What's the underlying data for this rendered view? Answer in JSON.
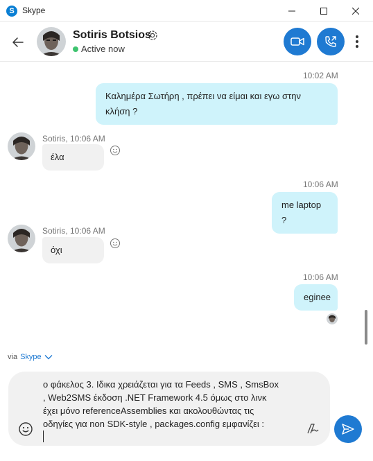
{
  "window": {
    "title": "Skype",
    "logo_letter": "S"
  },
  "header": {
    "contact_name": "Sotiris Botsios",
    "status": "Active now"
  },
  "messages": [
    {
      "direction": "out",
      "time": "10:02 AM",
      "text": "Καλημέρα Σωτήρη , πρέπει να είμαι και εγω στην κλήση ?"
    },
    {
      "direction": "in",
      "sender": "Sotiris, 10:06 AM",
      "text": "έλα"
    },
    {
      "direction": "out",
      "time": "10:06 AM",
      "text": "me laptop ?"
    },
    {
      "direction": "in",
      "sender": "Sotiris, 10:06 AM",
      "text": "όχι"
    },
    {
      "direction": "out",
      "time": "10:06 AM",
      "text": "eginee"
    }
  ],
  "via": {
    "prefix": "via",
    "link": "Skype"
  },
  "composer": {
    "text": "ο φάκελος 3. Ιδικα χρειάζεται για τα Feeds , SMS , SmsBox\n, Web2SMS έκδοση .NET Framework 4.5 όμως στο λινκ\nέχει μόνο referenceAssemblies και ακολουθώντας τις\nοδηγίες για non SDK-style , packages.config εμφανίζει :"
  },
  "colors": {
    "accent": "#1f7ad2",
    "outgoing_bubble": "#cff3fb",
    "incoming_bubble": "#f1f1f1",
    "online": "#3ec36f"
  }
}
